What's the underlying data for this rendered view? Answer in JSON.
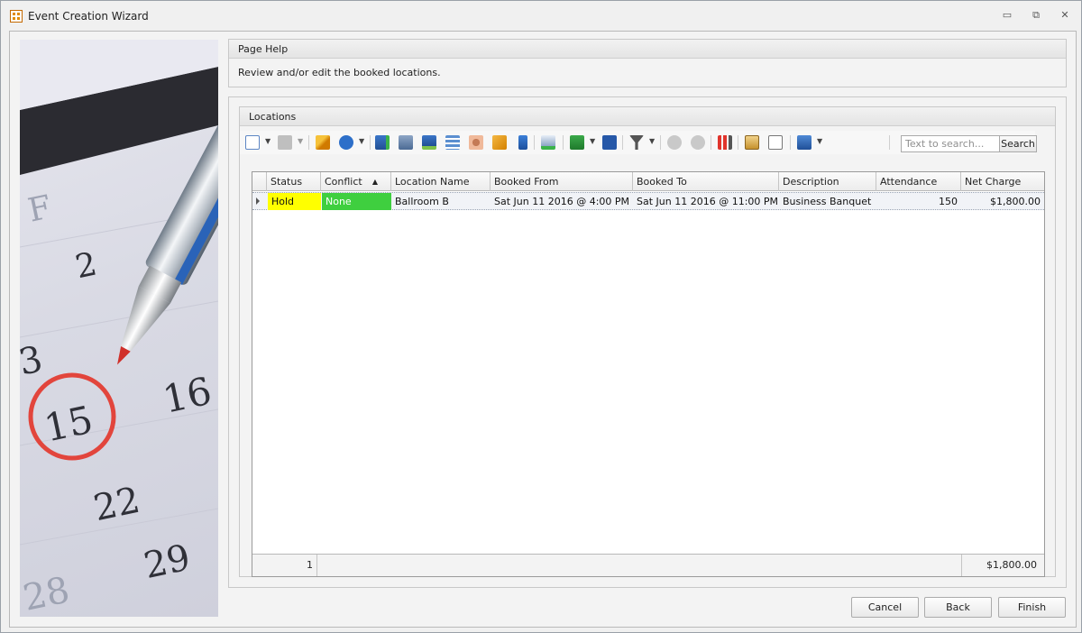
{
  "window": {
    "title": "Event Creation Wizard",
    "minimize_glyph": "▭",
    "restore_glyph": "⧉",
    "close_glyph": "✕"
  },
  "side_image": {
    "icon": "calendar-photo",
    "visible_numbers": [
      "F",
      "2",
      "3",
      "15",
      "16",
      "22",
      "28",
      "29"
    ]
  },
  "page_help": {
    "header": "Page Help",
    "text": "Review and/or edit the booked locations."
  },
  "locations": {
    "header": "Locations",
    "search": {
      "placeholder": "Text to search...",
      "button_label": "Search"
    },
    "columns": [
      {
        "label": "Status"
      },
      {
        "label": "Conflict",
        "sorted": "ascending"
      },
      {
        "label": "Location Name"
      },
      {
        "label": "Booked From"
      },
      {
        "label": "Booked To"
      },
      {
        "label": "Description"
      },
      {
        "label": "Attendance"
      },
      {
        "label": "Net Charge"
      }
    ],
    "rows": [
      {
        "status": "Hold",
        "conflict": "None",
        "location_name": "Ballroom B",
        "booked_from": "Sat Jun 11 2016 @ 4:00 PM",
        "booked_to": "Sat Jun 11 2016 @ 11:00 PM",
        "description": "Business Banquet",
        "attendance": "150",
        "net_charge": "$1,800.00"
      }
    ],
    "footer": {
      "count": "1",
      "total_net_charge": "$1,800.00"
    }
  },
  "colors": {
    "status_hold": "#ffff00",
    "conflict_none": "#3fcf3f",
    "selected_row": "#f1f3f7"
  },
  "buttons": {
    "cancel": "Cancel",
    "back": "Back",
    "finish": "Finish"
  }
}
